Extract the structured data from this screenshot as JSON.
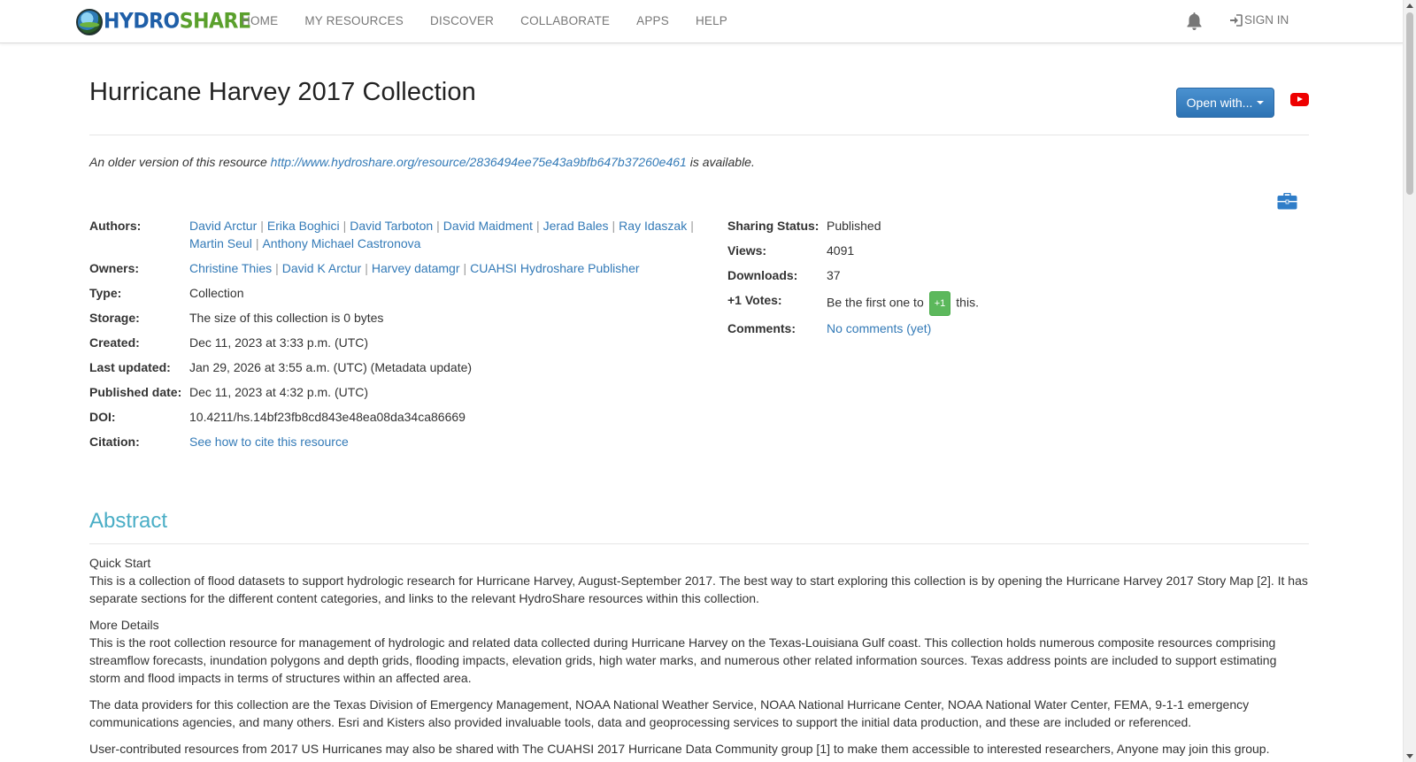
{
  "nav": {
    "logo_part1": "HYDRO",
    "logo_part2": "SHARE",
    "items": [
      "HOME",
      "MY RESOURCES",
      "DISCOVER",
      "COLLABORATE",
      "APPS",
      "HELP"
    ],
    "sign_in": "SIGN IN"
  },
  "resource": {
    "title": "Hurricane Harvey 2017 Collection",
    "open_with": "Open with...",
    "older_prefix": "An older version of this resource",
    "older_link": "http://www.hydroshare.org/resource/2836494ee75e43a9bfb647b37260e461",
    "older_suffix": "is available."
  },
  "meta": {
    "authors_label": "Authors:",
    "authors_line1": [
      "David Arctur",
      "Erika Boghici",
      "David Tarboton",
      "David Maidment",
      "Jerad Bales",
      "Ray Idaszak"
    ],
    "authors_line2": [
      "Martin Seul",
      "Anthony Michael Castronova"
    ],
    "owners_label": "Owners:",
    "owners": [
      "Christine Thies",
      "David K Arctur",
      "Harvey datamgr",
      "CUAHSI Hydroshare Publisher"
    ],
    "type_label": "Type:",
    "type_value": "Collection",
    "storage_label": "Storage:",
    "storage_value": "The size of this collection is 0 bytes",
    "created_label": "Created:",
    "created_value": "Dec 11, 2023 at 3:33 p.m. (UTC)",
    "updated_label": "Last updated:",
    "updated_value": "Jan 29, 2026 at 3:55 a.m. (UTC) (Metadata update)",
    "published_label": "Published date:",
    "published_value": "Dec 11, 2023 at 4:32 p.m. (UTC)",
    "doi_label": "DOI:",
    "doi_value": "10.4211/hs.14bf23fb8cd843e48ea08da34ca86669",
    "citation_label": "Citation:",
    "citation_value": "See how to cite this resource",
    "sharing_label": "Sharing Status:",
    "sharing_value": "Published",
    "views_label": "Views:",
    "views_value": "4091",
    "downloads_label": "Downloads:",
    "downloads_value": "37",
    "votes_label": "+1 Votes:",
    "votes_prefix": "Be the first one to",
    "votes_badge": "+1",
    "votes_suffix": "this.",
    "comments_label": "Comments:",
    "comments_value": "No comments (yet)"
  },
  "abstract": {
    "title": "Abstract",
    "quick_start_heading": "Quick Start",
    "quick_start_text": "This is a collection of flood datasets to support hydrologic research for Hurricane Harvey, August-September 2017. The best way to start exploring this collection is by opening the Hurricane Harvey 2017 Story Map [2]. It has separate sections for the different content categories, and links to the relevant HydroShare resources within this collection.",
    "more_details_heading": "More Details",
    "more_details_text": "This is the root collection resource for management of hydrologic and related data collected during Hurricane Harvey on the Texas-Louisiana Gulf coast. This collection holds numerous composite resources comprising streamflow forecasts, inundation polygons and depth grids, flooding impacts, elevation grids, high water marks, and numerous other related information sources. Texas address points are included to support estimating storm and flood impacts in terms of structures within an affected area.",
    "providers_text": "The data providers for this collection are the Texas Division of Emergency Management, NOAA National Weather Service, NOAA National Hurricane Center, NOAA National Water Center, FEMA, 9-1-1 emergency communications agencies, and many others. Esri and Kisters also provided invaluable tools, data and geoprocessing services to support the initial data production, and these are included or referenced.",
    "user_text": "User-contributed resources from 2017 US Hurricanes may also be shared with The CUAHSI 2017 Hurricane Data Community group [1] to make them accessible to interested researchers, Anyone may join this group."
  }
}
